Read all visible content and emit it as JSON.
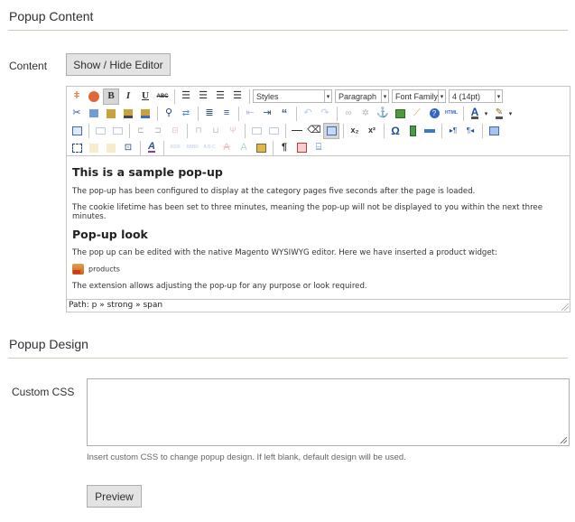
{
  "sections": {
    "content": {
      "title": "Popup Content"
    },
    "design": {
      "title": "Popup Design"
    }
  },
  "content_field": {
    "label": "Content",
    "toggle_button": "Show / Hide Editor"
  },
  "editor": {
    "toolbar": {
      "row1": {
        "styles": "Styles",
        "format": "Paragraph",
        "font_family": "Font Family",
        "font_size": "4 (14pt)",
        "bold": "B",
        "italic": "I",
        "underline": "U",
        "strikethrough": "ABC"
      },
      "row3": {
        "subscript": "x₂",
        "superscript": "x²",
        "special_char": "Ω",
        "pilcrow": "¶"
      },
      "row2": {
        "blockquote": "“",
        "html": "HTML",
        "forecolor": "A"
      }
    },
    "body": {
      "heading1": "This is a sample pop-up",
      "para1": "The pop-up has been configured to display at the category pages five seconds after the page is loaded.",
      "para2": "The cookie lifetime has been set to three minutes, meaning the pop-up will not be displayed to you within the next three minutes.",
      "heading2": "Pop-up look",
      "para3": "The pop up can be edited with the native Magento WYSIWYG editor. Here we have inserted a product widget:",
      "widget_label": "products",
      "para4": "The extension allows adjusting the pop-up for any purpose or look required."
    },
    "path": "Path: p » strong » span"
  },
  "custom_css_field": {
    "label": "Custom CSS",
    "value": "",
    "hint": "Insert custom CSS to change popup design. If left blank, default design will be used."
  },
  "preview_button": "Preview",
  "colors": {
    "rule": "#cfc8b8",
    "button_bg": "#e3e3e3",
    "text": "#303030"
  }
}
